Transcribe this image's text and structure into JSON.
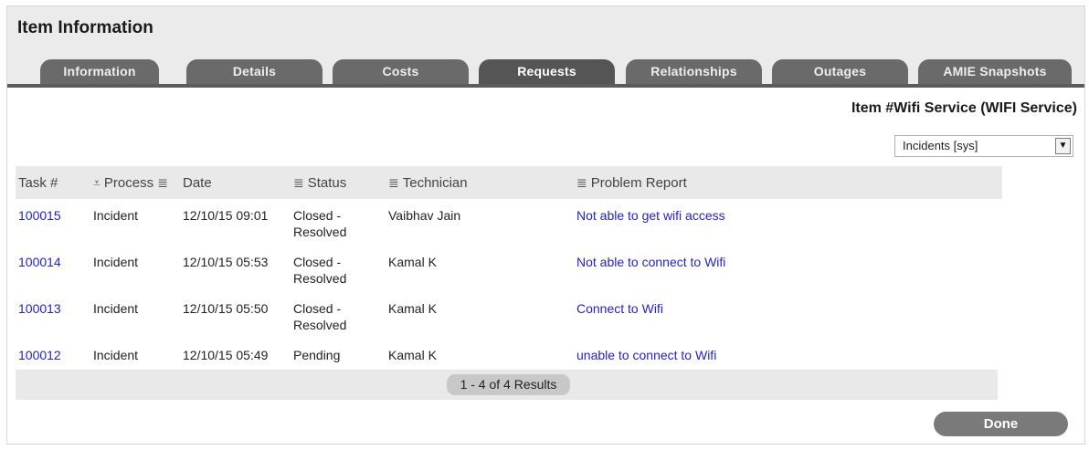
{
  "header": {
    "title": "Item Information"
  },
  "tabs": [
    {
      "label": "Information",
      "active": false
    },
    {
      "label": "Details",
      "active": false
    },
    {
      "label": "Costs",
      "active": false
    },
    {
      "label": "Requests",
      "active": true
    },
    {
      "label": "Relationships",
      "active": false
    },
    {
      "label": "Outages",
      "active": false
    },
    {
      "label": "AMIE Snapshots",
      "active": false
    }
  ],
  "item_heading": "Item #Wifi Service (WIFI Service)",
  "filter": {
    "selected": "Incidents [sys]"
  },
  "table": {
    "columns": [
      "Task #",
      "Process",
      "Date",
      "Status",
      "Technician",
      "Problem Report"
    ],
    "rows": [
      {
        "task": "100015",
        "process": "Incident",
        "date": "12/10/15 09:01",
        "status": [
          "Closed -",
          "Resolved"
        ],
        "technician": "Vaibhav Jain",
        "problem": "Not able to get wifi access"
      },
      {
        "task": "100014",
        "process": "Incident",
        "date": "12/10/15 05:53",
        "status": [
          "Closed -",
          "Resolved"
        ],
        "technician": "Kamal K",
        "problem": "Not able to connect to Wifi"
      },
      {
        "task": "100013",
        "process": "Incident",
        "date": "12/10/15 05:50",
        "status": [
          "Closed -",
          "Resolved"
        ],
        "technician": "Kamal K",
        "problem": "Connect to Wifi"
      },
      {
        "task": "100012",
        "process": "Incident",
        "date": "12/10/15 05:49",
        "status": [
          "Pending"
        ],
        "technician": "Kamal K",
        "problem": "unable to connect to Wifi"
      }
    ]
  },
  "pager": {
    "label": "1 - 4 of 4 Results"
  },
  "done_button": {
    "label": "Done"
  },
  "icons": {
    "filter_sort": "filter-icon",
    "column_menu": "menu-lines-icon",
    "dropdown": "dropdown-arrow-icon"
  }
}
